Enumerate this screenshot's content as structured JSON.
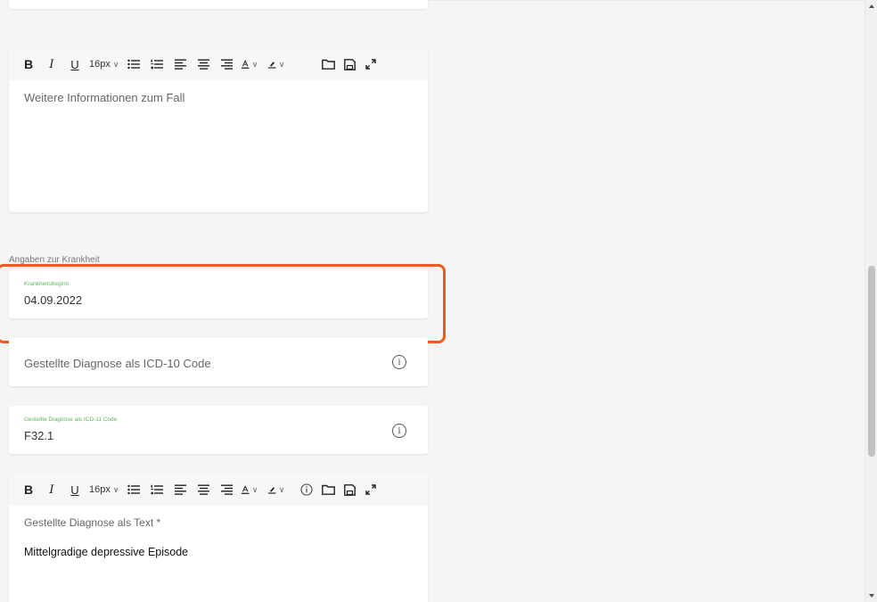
{
  "editor1": {
    "toolbar": {
      "bold": "B",
      "italic": "I",
      "underline": "U",
      "font_size": "16px",
      "icons": [
        "bullet-list-icon",
        "numbered-list-icon",
        "align-left-icon",
        "align-center-icon",
        "align-right-icon",
        "text-color-icon",
        "highlight-color-icon",
        "folder-icon",
        "save-icon",
        "expand-icon"
      ]
    },
    "placeholder": "Weitere Informationen zum Fall"
  },
  "section_label": "Angaben zur Krankheit",
  "onset": {
    "label": "Krankheitsbeginn",
    "value": "04.09.2022"
  },
  "icd10": {
    "placeholder": "Gestellte Diagnose als ICD-10 Code",
    "info": "i"
  },
  "icd11": {
    "label": "Gestellte Diagnose als ICD-11 Code",
    "value": "F32.1",
    "info": "i"
  },
  "editor2": {
    "toolbar": {
      "bold": "B",
      "italic": "I",
      "underline": "U",
      "font_size": "16px",
      "icons": [
        "bullet-list-icon",
        "numbered-list-icon",
        "align-left-icon",
        "align-center-icon",
        "align-right-icon",
        "text-color-icon",
        "highlight-color-icon",
        "info-icon",
        "folder-icon",
        "save-icon",
        "expand-icon"
      ]
    },
    "label": "Gestellte Diagnose als Text *",
    "value": "Mittelgradige depressive Episode"
  },
  "colors": {
    "highlight": "#f05a1a",
    "float_label": "#5cb85c"
  }
}
